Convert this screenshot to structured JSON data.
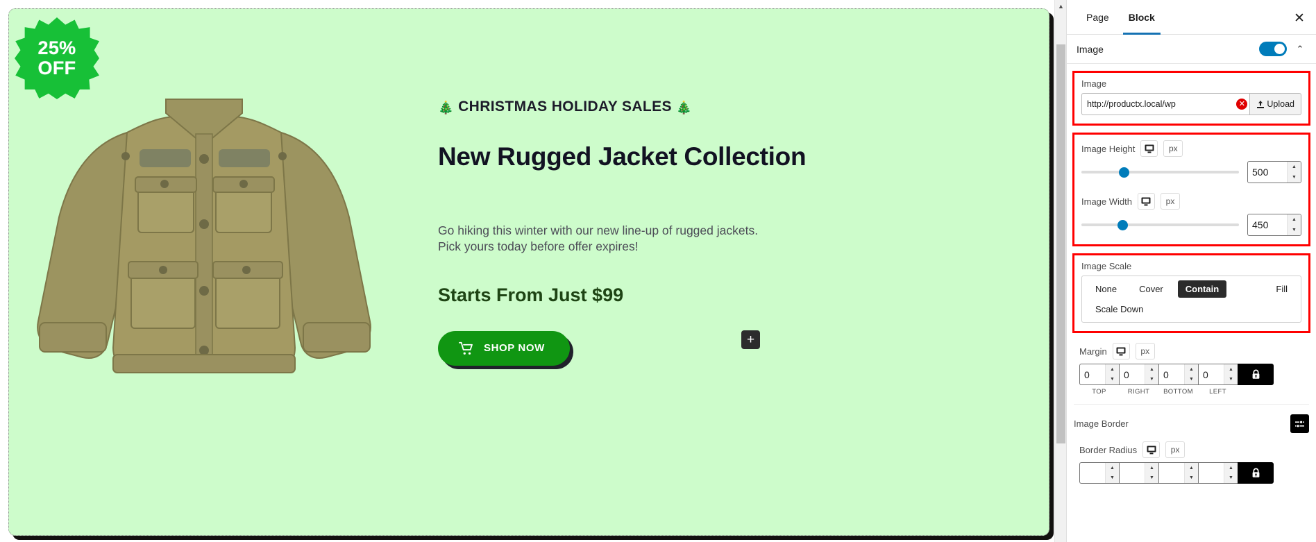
{
  "canvas": {
    "badge": {
      "line1": "25%",
      "line2": "OFF"
    },
    "eyebrow_tree_left": "🎄",
    "eyebrow_text": "CHRISTMAS HOLIDAY SALES",
    "eyebrow_tree_right": "🎄",
    "headline": "New Rugged Jacket Collection",
    "subcopy_line1": "Go hiking this winter with our new line-up of rugged jackets.",
    "subcopy_line2": "Pick yours today before offer expires!",
    "price": "Starts From Just $99",
    "cta_label": "SHOP NOW",
    "cta_icon": "shopping-cart-icon",
    "add_block_label": "+",
    "background_color": "#cdfccb",
    "cta_color": "#109612",
    "badge_color": "#17c037"
  },
  "sidebar": {
    "tabs": [
      {
        "label": "Page",
        "active": false
      },
      {
        "label": "Block",
        "active": true
      }
    ],
    "close_icon": "✕",
    "panel": {
      "title": "Image",
      "toggle_on": true,
      "collapse_icon": "⌃"
    },
    "image_group": {
      "label": "Image",
      "url_value": "http://productx.local/wp",
      "url_placeholder": "http://productx.local/wp",
      "clear_icon": "✕",
      "upload_label": "Upload",
      "upload_icon": "upload-icon"
    },
    "size_group": {
      "height": {
        "label": "Image Height",
        "device_icon": "desktop-icon",
        "unit": "px",
        "value": "500",
        "slider_percent": 27
      },
      "width": {
        "label": "Image Width",
        "device_icon": "desktop-icon",
        "unit": "px",
        "value": "450",
        "slider_percent": 26
      }
    },
    "scale_group": {
      "label": "Image Scale",
      "options": [
        "None",
        "Cover",
        "Contain",
        "Fill",
        "Scale Down"
      ],
      "selected": "Contain"
    },
    "margin_group": {
      "label": "Margin",
      "device_icon": "desktop-icon",
      "unit": "px",
      "values": [
        "0",
        "0",
        "0",
        "0"
      ],
      "side_labels": [
        "TOP",
        "RIGHT",
        "BOTTOM",
        "LEFT"
      ],
      "lock_icon": "lock-icon"
    },
    "border_group": {
      "label": "Image Border",
      "settings_icon": "sliders-icon"
    },
    "radius_group": {
      "label": "Border Radius",
      "device_icon": "desktop-icon",
      "unit": "px",
      "values": [
        "",
        "",
        "",
        ""
      ],
      "lock_icon": "lock-icon"
    }
  },
  "colors": {
    "accent": "#007cba",
    "highlight_outline": "#ff0000",
    "tab_underline": "#1572b3"
  }
}
